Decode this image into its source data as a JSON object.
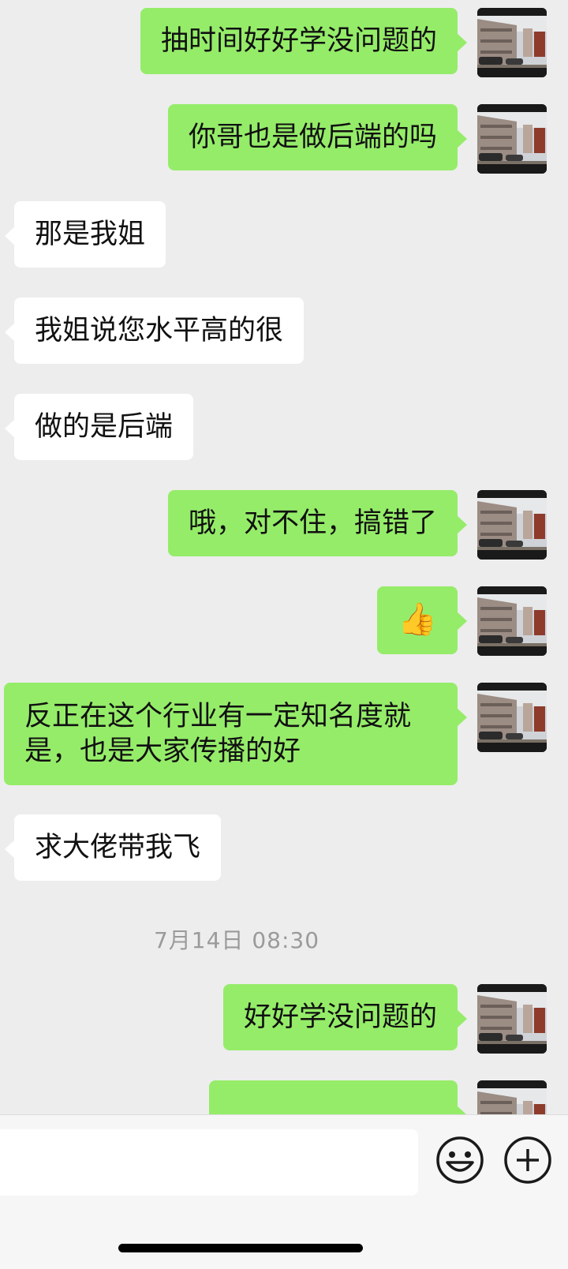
{
  "messages": [
    {
      "side": "me",
      "text": "抽时间好好学没问题的"
    },
    {
      "side": "me",
      "text": "你哥也是做后端的吗"
    },
    {
      "side": "them",
      "text": "那是我姐"
    },
    {
      "side": "them",
      "text": "我姐说您水平高的很"
    },
    {
      "side": "them",
      "text": "做的是后端"
    },
    {
      "side": "me",
      "text": "哦，对不住，搞错了"
    },
    {
      "side": "me",
      "text": "👍"
    },
    {
      "side": "me",
      "text": "反正在这个行业有一定知名度就是，也是大家传播的好"
    },
    {
      "side": "them",
      "text": "求大佬带我飞"
    },
    {
      "side": "me",
      "text": "好好学没问题的"
    }
  ],
  "timestamp": "7月14日 08:30",
  "input": {
    "value": ""
  },
  "icons": {
    "emoji": "emoji-icon",
    "plus": "plus-icon",
    "avatar": "avatar"
  }
}
